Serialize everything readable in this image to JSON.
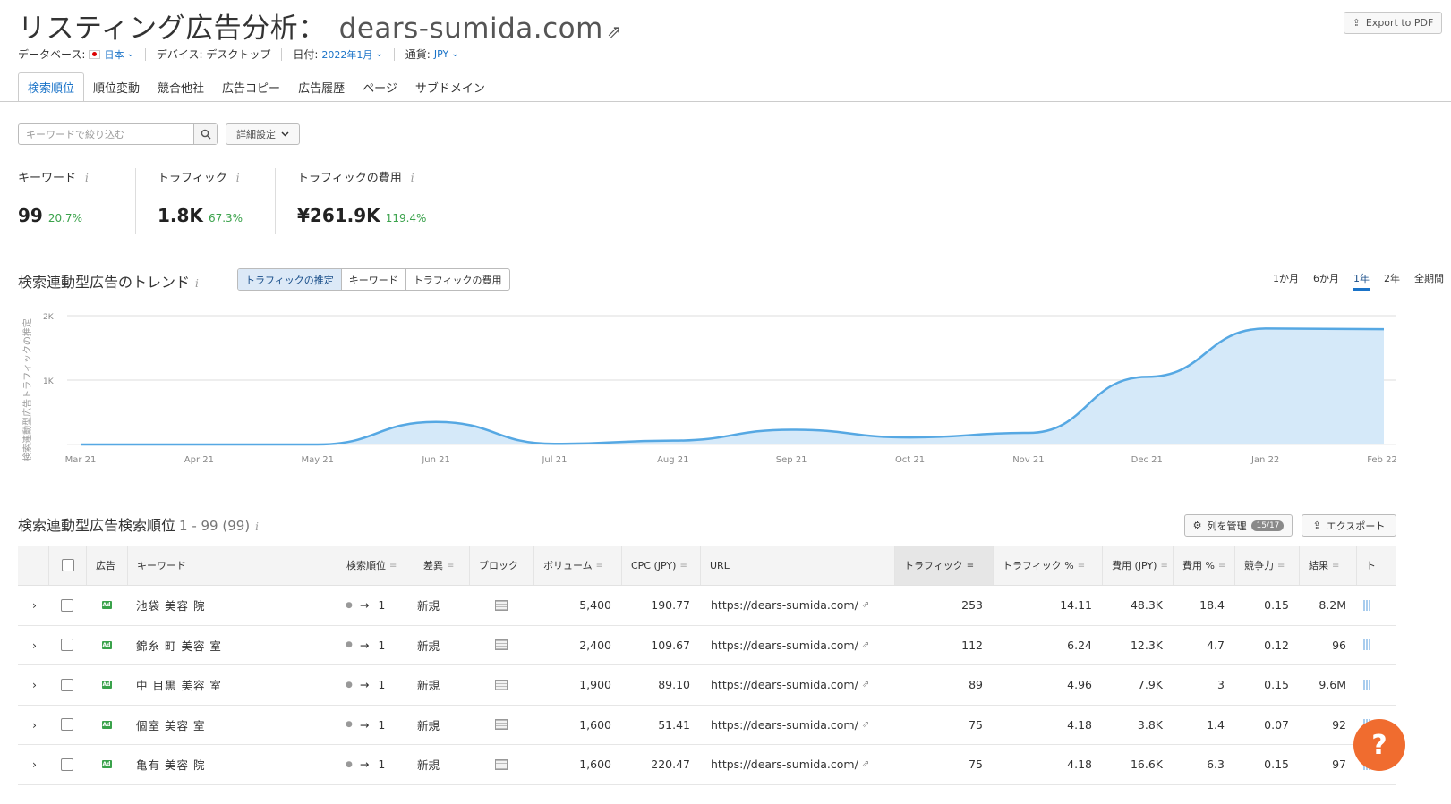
{
  "header": {
    "title": "リスティング広告分析：",
    "domain": "dears-sumida.com",
    "export_pdf": "Export to PDF"
  },
  "filters": {
    "database_label": "データベース:",
    "database_value": "日本",
    "device": "デバイス: デスクトップ",
    "date_label": "日付:",
    "date_value": "2022年1月",
    "currency_label": "通貨:",
    "currency_value": "JPY"
  },
  "tabs": [
    "検索順位",
    "順位変動",
    "競合他社",
    "広告コピー",
    "広告履歴",
    "ページ",
    "サブドメイン"
  ],
  "search": {
    "placeholder": "キーワードで絞り込む",
    "advanced": "詳細設定"
  },
  "metrics": [
    {
      "label": "キーワード",
      "value": "99",
      "change": "20.7%"
    },
    {
      "label": "トラフィック",
      "value": "1.8K",
      "change": "67.3%"
    },
    {
      "label": "トラフィックの費用",
      "value": "¥261.9K",
      "change": "119.4%"
    }
  ],
  "trend": {
    "title": "検索連動型広告のトレンド",
    "segments": [
      "トラフィックの推定",
      "キーワード",
      "トラフィックの費用"
    ],
    "periods": [
      "1か月",
      "6か月",
      "1年",
      "2年",
      "全期間"
    ]
  },
  "chart_data": {
    "type": "area",
    "ylabel": "検索連動型広告トラフィックの推定",
    "y_ticks": [
      "1K",
      "2K"
    ],
    "ylim": [
      0,
      2000
    ],
    "categories": [
      "Mar 21",
      "Apr 21",
      "May 21",
      "Jun 21",
      "Jul 21",
      "Aug 21",
      "Sep 21",
      "Oct 21",
      "Nov 21",
      "Dec 21",
      "Jan 22",
      "Feb 22"
    ],
    "values": [
      0,
      0,
      0,
      350,
      10,
      60,
      230,
      110,
      180,
      1050,
      1800,
      1790
    ],
    "grid": true,
    "color": "#56a8e3"
  },
  "list": {
    "title": "検索連動型広告検索順位",
    "range": "1 - 99 (99)",
    "manage_cols": "列を管理",
    "manage_badge": "15/17",
    "export": "エクスポート"
  },
  "table": {
    "columns": [
      "広告",
      "キーワード",
      "検索順位",
      "差異",
      "ブロック",
      "ボリューム",
      "CPC (JPY)",
      "URL",
      "トラフィック",
      "トラフィック %",
      "費用 (JPY)",
      "費用 %",
      "競争力",
      "結果",
      "ト"
    ],
    "rows": [
      {
        "keyword": "池袋 美容 院",
        "pos_to": "1",
        "diff": "新規",
        "volume": "5,400",
        "cpc": "190.77",
        "url": "https://dears-sumida.com/",
        "traffic": "253",
        "traffic_pct": "14.11",
        "cost": "48.3K",
        "cost_pct": "18.4",
        "comp": "0.15",
        "results": "8.2M"
      },
      {
        "keyword": "錦糸 町 美容 室",
        "pos_to": "1",
        "diff": "新規",
        "volume": "2,400",
        "cpc": "109.67",
        "url": "https://dears-sumida.com/",
        "traffic": "112",
        "traffic_pct": "6.24",
        "cost": "12.3K",
        "cost_pct": "4.7",
        "comp": "0.12",
        "results": "96"
      },
      {
        "keyword": "中 目黒 美容 室",
        "pos_to": "1",
        "diff": "新規",
        "volume": "1,900",
        "cpc": "89.10",
        "url": "https://dears-sumida.com/",
        "traffic": "89",
        "traffic_pct": "4.96",
        "cost": "7.9K",
        "cost_pct": "3",
        "comp": "0.15",
        "results": "9.6M"
      },
      {
        "keyword": "個室 美容 室",
        "pos_to": "1",
        "diff": "新規",
        "volume": "1,600",
        "cpc": "51.41",
        "url": "https://dears-sumida.com/",
        "traffic": "75",
        "traffic_pct": "4.18",
        "cost": "3.8K",
        "cost_pct": "1.4",
        "comp": "0.07",
        "results": "92"
      },
      {
        "keyword": "亀有 美容 院",
        "pos_to": "1",
        "diff": "新規",
        "volume": "1,600",
        "cpc": "220.47",
        "url": "https://dears-sumida.com/",
        "traffic": "75",
        "traffic_pct": "4.18",
        "cost": "16.6K",
        "cost_pct": "6.3",
        "comp": "0.15",
        "results": "97"
      }
    ]
  },
  "help": "?"
}
